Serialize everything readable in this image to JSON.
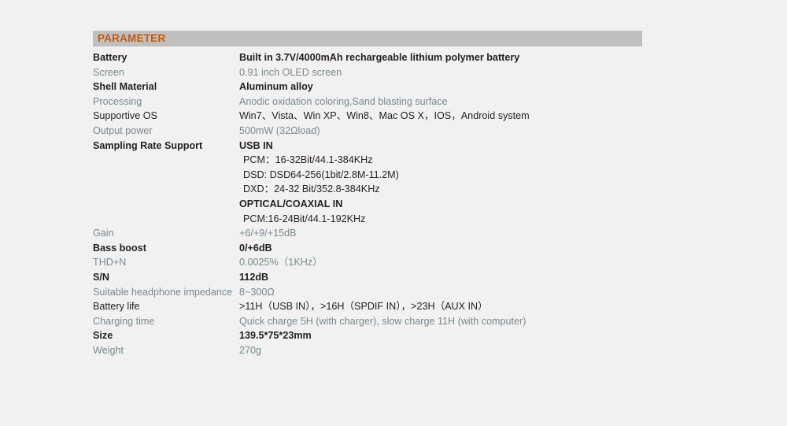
{
  "section": {
    "title": "PARAMETER",
    "title_color": "#c25a12",
    "bar_color": "#bfbfbf",
    "page_background": "#f1f1f1",
    "dark_text_color": "#231f20",
    "muted_text_color": "#78888f"
  },
  "rows": [
    {
      "label": "Battery",
      "value": "Built in 3.7V/4000mAh rechargeable lithium polymer battery",
      "tone": "dark"
    },
    {
      "label": "Screen",
      "value": "0.91 inch OLED screen",
      "tone": "muted"
    },
    {
      "label": "Shell Material",
      "value": "Aluminum alloy",
      "tone": "dark"
    },
    {
      "label": "Processing",
      "value": "Anodic oxidation coloring,Sand blasting surface",
      "tone": "muted"
    },
    {
      "label": "Supportive OS",
      "value": "Win7、Vista、Win XP、Win8、Mac OS X，IOS，Android system",
      "tone": "dark",
      "weight": "normal"
    },
    {
      "label": "Output power",
      "value": "500mW (32Ωload)",
      "tone": "muted"
    },
    {
      "label": "Sampling Rate Support",
      "value": "",
      "tone": "dark",
      "sub_lines": [
        {
          "text": "USB IN",
          "strong": true
        },
        {
          "text": "PCM：16-32Bit/44.1-384KHz",
          "strong": false
        },
        {
          "text": "DSD: DSD64-256(1bit/2.8M-11.2M)",
          "strong": false
        },
        {
          "text": "DXD：24-32 Bit/352.8-384KHz",
          "strong": false
        },
        {
          "text": "OPTICAL/COAXIAL IN",
          "strong": true
        },
        {
          "text": "PCM:16-24Bit/44.1-192KHz",
          "strong": false
        }
      ]
    },
    {
      "label": "Gain",
      "value": "+6/+9/+15dB",
      "tone": "muted"
    },
    {
      "label": "Bass boost",
      "value": "0/+6dB",
      "tone": "dark"
    },
    {
      "label": "THD+N",
      "value": "0.0025%（1KHz）",
      "tone": "muted"
    },
    {
      "label": "S/N",
      "value": "112dB",
      "tone": "dark"
    },
    {
      "label": "Suitable headphone impedance",
      "value": "8~300Ω",
      "tone": "muted"
    },
    {
      "label": "Battery life",
      "value": ">11H（USB IN），>16H（SPDIF IN），>23H（AUX IN）",
      "tone": "dark",
      "weight": "normal"
    },
    {
      "label": "Charging time",
      "value": "Quick charge 5H (with charger), slow charge 11H (with computer)",
      "tone": "muted"
    },
    {
      "label": "Size",
      "value": "139.5*75*23mm",
      "tone": "dark"
    },
    {
      "label": "Weight",
      "value": "270g",
      "tone": "muted"
    }
  ]
}
